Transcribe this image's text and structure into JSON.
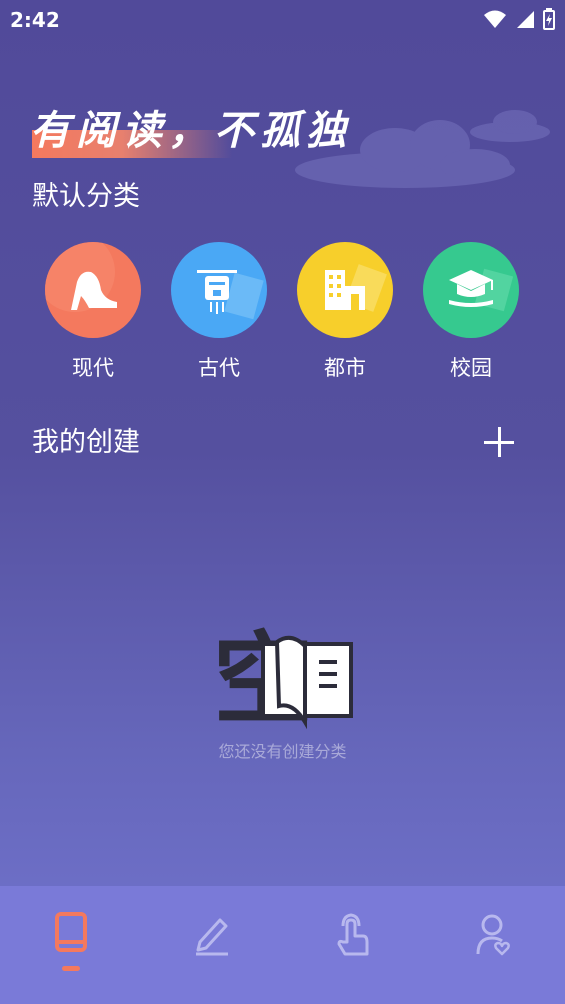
{
  "status_bar": {
    "time": "2:42"
  },
  "banner": {
    "slogan": "有阅读，不孤独"
  },
  "default_section": {
    "title": "默认分类",
    "categories": [
      {
        "label": "现代",
        "icon": "high-heel-icon",
        "color": "#f4795e"
      },
      {
        "label": "古代",
        "icon": "ancient-scroll-icon",
        "color": "#4aa8f5"
      },
      {
        "label": "都市",
        "icon": "city-building-icon",
        "color": "#f7cf2b"
      },
      {
        "label": "校园",
        "icon": "graduation-cap-icon",
        "color": "#36c98f"
      }
    ]
  },
  "my_section": {
    "title": "我的创建",
    "add_icon": "plus-icon"
  },
  "empty_state": {
    "glyph": "空",
    "icon": "open-book-icon",
    "message": "您还没有创建分类"
  },
  "tabbar": {
    "active_color": "#f4795e",
    "tabs": [
      {
        "icon": "bookshelf-icon",
        "active": true
      },
      {
        "icon": "pencil-icon",
        "active": false
      },
      {
        "icon": "tap-hand-icon",
        "active": false
      },
      {
        "icon": "user-heart-icon",
        "active": false
      }
    ]
  }
}
